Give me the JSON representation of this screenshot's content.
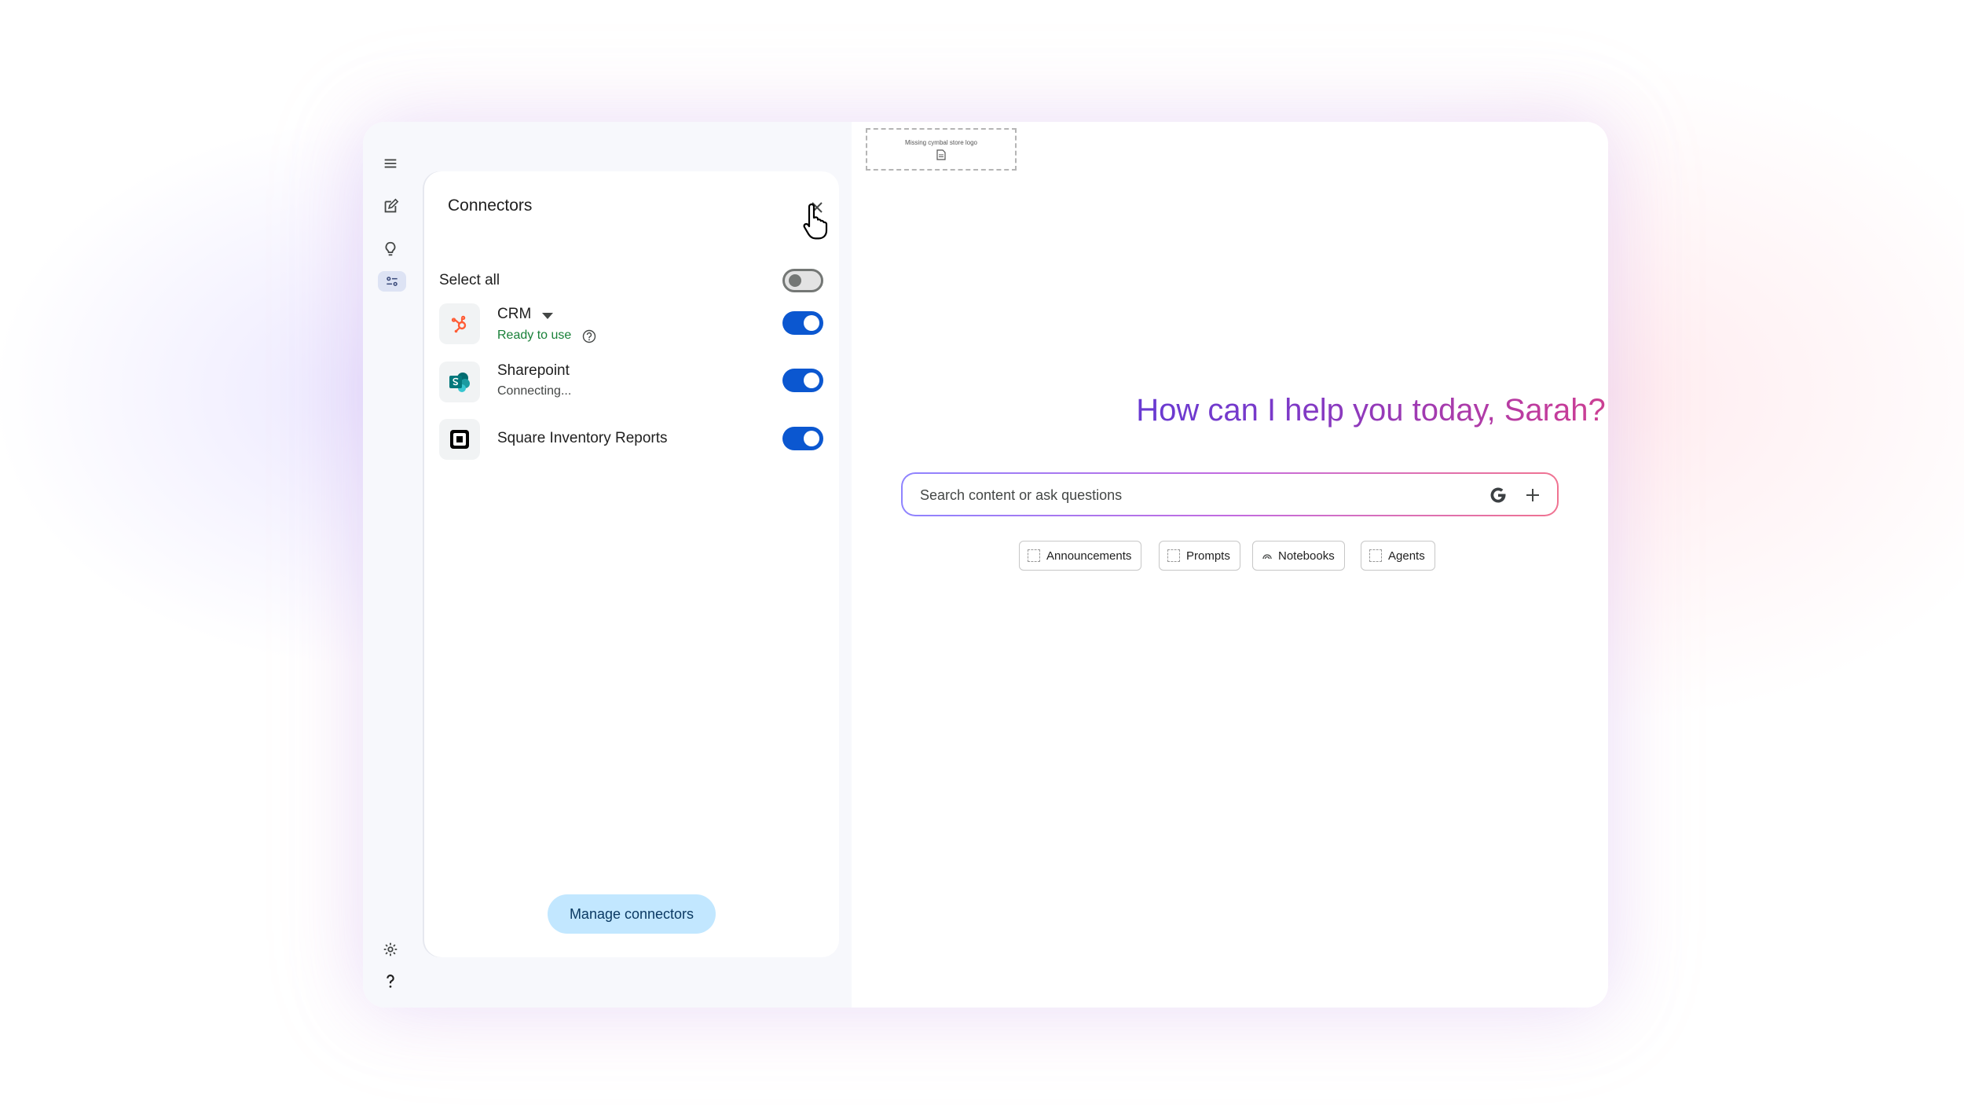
{
  "panel": {
    "title": "Connectors",
    "select_all_label": "Select all",
    "select_all_on": false,
    "manage_button": "Manage connectors"
  },
  "connectors": [
    {
      "name": "CRM",
      "status": "Ready to use",
      "status_color": "#188038",
      "enabled": true,
      "icon": "hubspot-icon",
      "has_dropdown": true,
      "has_help": true
    },
    {
      "name": "Sharepoint",
      "status": "Connecting...",
      "status_color": "#444746",
      "enabled": true,
      "icon": "sharepoint-icon"
    },
    {
      "name": "Square Inventory Reports",
      "status": "",
      "enabled": true,
      "icon": "square-icon"
    }
  ],
  "rail": {
    "icons": [
      "menu-icon",
      "new-chat-icon",
      "lightbulb-icon",
      "connectors-icon",
      "settings-icon",
      "help-icon"
    ]
  },
  "main": {
    "logo_placeholder_text": "Missing cymbal store logo",
    "greeting": "How can I help you today, Sarah?",
    "search_placeholder": "Search content or ask questions",
    "chips": [
      "Announcements",
      "Prompts",
      "Notebooks",
      "Agents"
    ]
  },
  "colors": {
    "accent": "#0b57d0",
    "manage_button_bg": "#c2e7ff",
    "greeting_gradient_start": "#4c3ce0",
    "greeting_gradient_end": "#ea4f6a"
  }
}
